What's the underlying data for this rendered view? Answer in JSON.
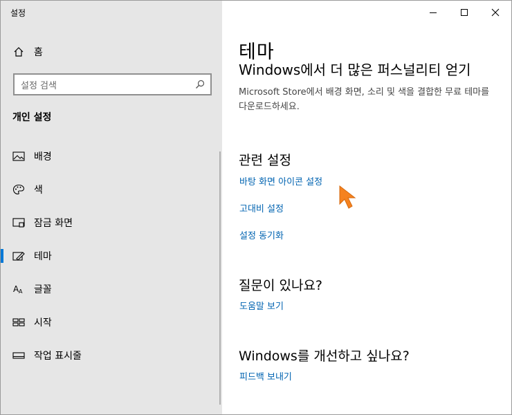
{
  "window": {
    "app_title": "설정"
  },
  "sidebar": {
    "home_label": "홈",
    "search": {
      "placeholder": "설정 검색"
    },
    "section_title": "개인 설정",
    "items": [
      {
        "label": "배경",
        "icon": "image-icon"
      },
      {
        "label": "색",
        "icon": "palette-icon"
      },
      {
        "label": "잠금 화면",
        "icon": "lock-screen-icon"
      },
      {
        "label": "테마",
        "icon": "theme-icon",
        "active": true
      },
      {
        "label": "글꼴",
        "icon": "font-icon"
      },
      {
        "label": "시작",
        "icon": "start-icon"
      },
      {
        "label": "작업 표시줄",
        "icon": "taskbar-icon"
      }
    ]
  },
  "main": {
    "title": "테마",
    "partial_heading": "Windows에서 더 많은 퍼스널리티 얻기",
    "description": "Microsoft Store에서 배경 화면, 소리 및 색을 결합한 무료 테마를 다운로드하세요.",
    "related": {
      "heading": "관련 설정",
      "links": [
        "바탕 화면 아이콘 설정",
        "고대비 설정",
        "설정 동기화"
      ]
    },
    "question": {
      "heading": "질문이 있나요?",
      "link": "도움말 보기"
    },
    "improve": {
      "heading": "Windows를 개선하고 싶나요?",
      "link": "피드백 보내기"
    }
  },
  "colors": {
    "accent": "#0078d7",
    "link": "#0063b1",
    "sidebar_bg": "#e6e6e6",
    "cursor": "#f5821f"
  }
}
